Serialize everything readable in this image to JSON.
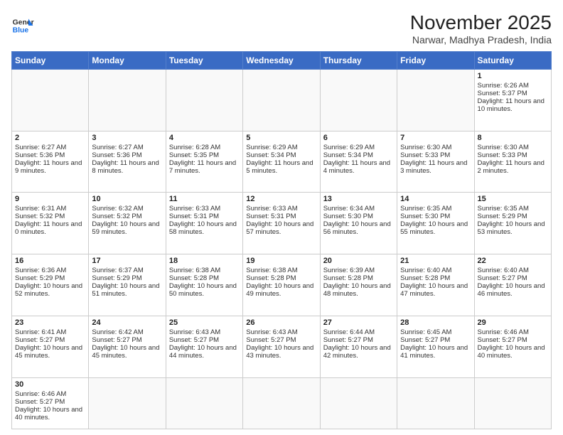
{
  "logo": {
    "line1": "General",
    "line2": "Blue"
  },
  "title": "November 2025",
  "location": "Narwar, Madhya Pradesh, India",
  "weekdays": [
    "Sunday",
    "Monday",
    "Tuesday",
    "Wednesday",
    "Thursday",
    "Friday",
    "Saturday"
  ],
  "weeks": [
    [
      {
        "day": "",
        "info": ""
      },
      {
        "day": "",
        "info": ""
      },
      {
        "day": "",
        "info": ""
      },
      {
        "day": "",
        "info": ""
      },
      {
        "day": "",
        "info": ""
      },
      {
        "day": "",
        "info": ""
      },
      {
        "day": "1",
        "info": "Sunrise: 6:26 AM\nSunset: 5:37 PM\nDaylight: 11 hours and 10 minutes."
      }
    ],
    [
      {
        "day": "2",
        "info": "Sunrise: 6:27 AM\nSunset: 5:36 PM\nDaylight: 11 hours and 9 minutes."
      },
      {
        "day": "3",
        "info": "Sunrise: 6:27 AM\nSunset: 5:36 PM\nDaylight: 11 hours and 8 minutes."
      },
      {
        "day": "4",
        "info": "Sunrise: 6:28 AM\nSunset: 5:35 PM\nDaylight: 11 hours and 7 minutes."
      },
      {
        "day": "5",
        "info": "Sunrise: 6:29 AM\nSunset: 5:34 PM\nDaylight: 11 hours and 5 minutes."
      },
      {
        "day": "6",
        "info": "Sunrise: 6:29 AM\nSunset: 5:34 PM\nDaylight: 11 hours and 4 minutes."
      },
      {
        "day": "7",
        "info": "Sunrise: 6:30 AM\nSunset: 5:33 PM\nDaylight: 11 hours and 3 minutes."
      },
      {
        "day": "8",
        "info": "Sunrise: 6:30 AM\nSunset: 5:33 PM\nDaylight: 11 hours and 2 minutes."
      }
    ],
    [
      {
        "day": "9",
        "info": "Sunrise: 6:31 AM\nSunset: 5:32 PM\nDaylight: 11 hours and 0 minutes."
      },
      {
        "day": "10",
        "info": "Sunrise: 6:32 AM\nSunset: 5:32 PM\nDaylight: 10 hours and 59 minutes."
      },
      {
        "day": "11",
        "info": "Sunrise: 6:33 AM\nSunset: 5:31 PM\nDaylight: 10 hours and 58 minutes."
      },
      {
        "day": "12",
        "info": "Sunrise: 6:33 AM\nSunset: 5:31 PM\nDaylight: 10 hours and 57 minutes."
      },
      {
        "day": "13",
        "info": "Sunrise: 6:34 AM\nSunset: 5:30 PM\nDaylight: 10 hours and 56 minutes."
      },
      {
        "day": "14",
        "info": "Sunrise: 6:35 AM\nSunset: 5:30 PM\nDaylight: 10 hours and 55 minutes."
      },
      {
        "day": "15",
        "info": "Sunrise: 6:35 AM\nSunset: 5:29 PM\nDaylight: 10 hours and 53 minutes."
      }
    ],
    [
      {
        "day": "16",
        "info": "Sunrise: 6:36 AM\nSunset: 5:29 PM\nDaylight: 10 hours and 52 minutes."
      },
      {
        "day": "17",
        "info": "Sunrise: 6:37 AM\nSunset: 5:29 PM\nDaylight: 10 hours and 51 minutes."
      },
      {
        "day": "18",
        "info": "Sunrise: 6:38 AM\nSunset: 5:28 PM\nDaylight: 10 hours and 50 minutes."
      },
      {
        "day": "19",
        "info": "Sunrise: 6:38 AM\nSunset: 5:28 PM\nDaylight: 10 hours and 49 minutes."
      },
      {
        "day": "20",
        "info": "Sunrise: 6:39 AM\nSunset: 5:28 PM\nDaylight: 10 hours and 48 minutes."
      },
      {
        "day": "21",
        "info": "Sunrise: 6:40 AM\nSunset: 5:28 PM\nDaylight: 10 hours and 47 minutes."
      },
      {
        "day": "22",
        "info": "Sunrise: 6:40 AM\nSunset: 5:27 PM\nDaylight: 10 hours and 46 minutes."
      }
    ],
    [
      {
        "day": "23",
        "info": "Sunrise: 6:41 AM\nSunset: 5:27 PM\nDaylight: 10 hours and 45 minutes."
      },
      {
        "day": "24",
        "info": "Sunrise: 6:42 AM\nSunset: 5:27 PM\nDaylight: 10 hours and 45 minutes."
      },
      {
        "day": "25",
        "info": "Sunrise: 6:43 AM\nSunset: 5:27 PM\nDaylight: 10 hours and 44 minutes."
      },
      {
        "day": "26",
        "info": "Sunrise: 6:43 AM\nSunset: 5:27 PM\nDaylight: 10 hours and 43 minutes."
      },
      {
        "day": "27",
        "info": "Sunrise: 6:44 AM\nSunset: 5:27 PM\nDaylight: 10 hours and 42 minutes."
      },
      {
        "day": "28",
        "info": "Sunrise: 6:45 AM\nSunset: 5:27 PM\nDaylight: 10 hours and 41 minutes."
      },
      {
        "day": "29",
        "info": "Sunrise: 6:46 AM\nSunset: 5:27 PM\nDaylight: 10 hours and 40 minutes."
      }
    ],
    [
      {
        "day": "30",
        "info": "Sunrise: 6:46 AM\nSunset: 5:27 PM\nDaylight: 10 hours and 40 minutes."
      },
      {
        "day": "",
        "info": ""
      },
      {
        "day": "",
        "info": ""
      },
      {
        "day": "",
        "info": ""
      },
      {
        "day": "",
        "info": ""
      },
      {
        "day": "",
        "info": ""
      },
      {
        "day": "",
        "info": ""
      }
    ]
  ]
}
